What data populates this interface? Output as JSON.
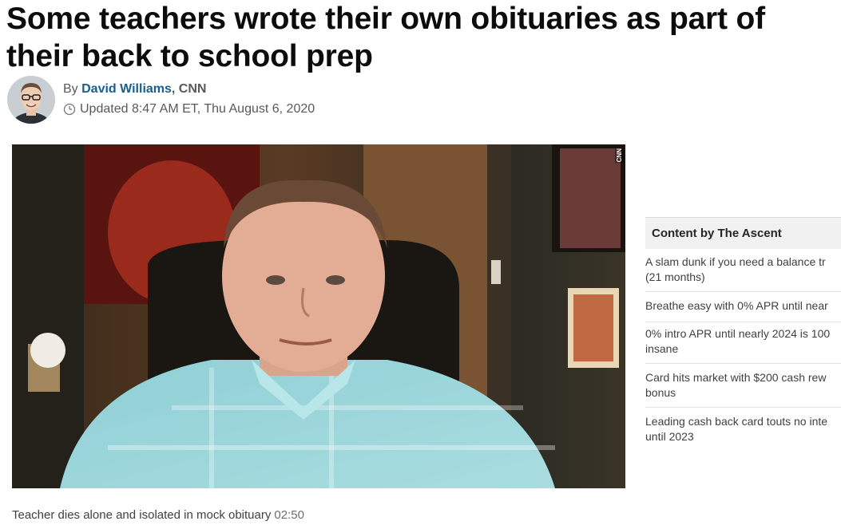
{
  "article": {
    "headline_line1": "Some teachers wrote their own obituaries as part of",
    "headline_line2": "their back to school prep",
    "byline_prefix": "By",
    "author": "David Williams",
    "byline_source": ", CNN",
    "updated": "Updated 8:47 AM ET, Thu August 6, 2020"
  },
  "video": {
    "watermark": "CNN",
    "caption": "Teacher dies alone and isolated in mock obituary",
    "duration": "02:50"
  },
  "sidebar": {
    "title": "Content by The Ascent",
    "items": [
      {
        "line1": "A slam dunk if you need a balance tr",
        "line2": "(21 months)"
      },
      {
        "line1": "Breathe easy with 0% APR until near",
        "line2": ""
      },
      {
        "line1": "0% intro APR until nearly 2024 is 100",
        "line2": "insane"
      },
      {
        "line1": "Card hits market with $200 cash rew",
        "line2": "bonus"
      },
      {
        "line1": "Leading cash back card touts no inte",
        "line2": "until 2023"
      }
    ]
  },
  "icons": {
    "clock": "clock-icon",
    "avatar": "author-avatar"
  },
  "colors": {
    "author_link": "#1a5d8f",
    "headline": "#0c0c0c",
    "sidebar_header_bg": "#f1f1f1"
  }
}
